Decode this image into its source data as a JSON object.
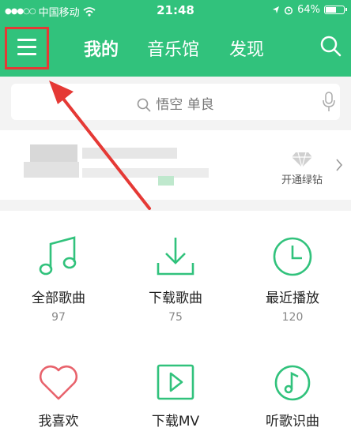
{
  "status_bar": {
    "carrier": "中国移动",
    "time": "21:48",
    "battery": "64%",
    "battery_level": 0.64
  },
  "nav": {
    "tabs": [
      {
        "label": "我的"
      },
      {
        "label": "音乐馆"
      },
      {
        "label": "发现"
      }
    ]
  },
  "search": {
    "placeholder": "悟空 单良"
  },
  "profile": {
    "vip_label": "开通绿钻"
  },
  "grid": [
    {
      "label": "全部歌曲",
      "count": "97",
      "icon": "music-note-icon"
    },
    {
      "label": "下载歌曲",
      "count": "75",
      "icon": "download-icon"
    },
    {
      "label": "最近播放",
      "count": "120",
      "icon": "clock-icon"
    },
    {
      "label": "我喜欢",
      "icon": "heart-icon"
    },
    {
      "label": "下载MV",
      "icon": "video-play-icon"
    },
    {
      "label": "听歌识曲",
      "icon": "music-recognize-icon"
    }
  ],
  "colors": {
    "accent": "#31c27c",
    "highlight": "#e53935"
  }
}
